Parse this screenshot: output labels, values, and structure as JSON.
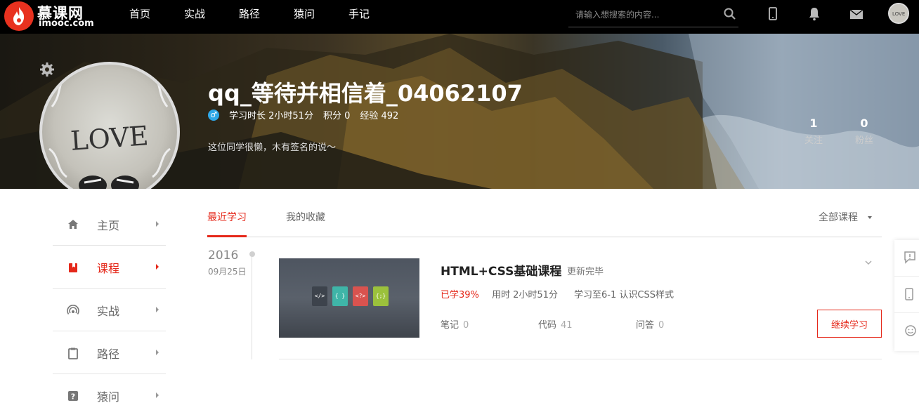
{
  "logo": {
    "cn": "慕课网",
    "en": "imooc.com"
  },
  "nav": {
    "items": [
      "首页",
      "实战",
      "路径",
      "猿问",
      "手记"
    ]
  },
  "search": {
    "placeholder": "请输入想搜索的内容..."
  },
  "profile": {
    "username": "qq_等待并相信着_04062107",
    "gender_icon": "male-icon",
    "study_time": "学习时长 2小时51分",
    "points": "积分 0",
    "experience": "经验 492",
    "signature": "这位同学很懒，木有签名的说～",
    "following_count": "1",
    "following_label": "关注",
    "followers_count": "0",
    "followers_label": "粉丝"
  },
  "sidebar": {
    "items": [
      {
        "label": "主页",
        "icon": "home-icon"
      },
      {
        "label": "课程",
        "icon": "book-icon"
      },
      {
        "label": "实战",
        "icon": "broadcast-icon"
      },
      {
        "label": "路径",
        "icon": "clipboard-icon"
      },
      {
        "label": "猿问",
        "icon": "question-icon"
      }
    ],
    "active_index": 1
  },
  "tabs": {
    "recent": "最近学习",
    "favorites": "我的收藏",
    "filter": "全部课程"
  },
  "timeline": {
    "year": "2016",
    "date": "09月25日"
  },
  "course": {
    "title": "HTML+CSS基础课程",
    "status": "更新完毕",
    "progress": "已学39%",
    "time": "用时 2小时51分",
    "learned_to": "学习至6-1 认识CSS样式",
    "notes_label": "笔记",
    "notes_value": "0",
    "code_label": "代码",
    "code_value": "41",
    "qa_label": "问答",
    "qa_value": "0",
    "continue_label": "继续学习",
    "thumb_files": [
      "</>",
      "{ }",
      "<?>",
      "{;}"
    ]
  },
  "colors": {
    "accent": "#e5281a",
    "nav_bg": "#000000"
  }
}
